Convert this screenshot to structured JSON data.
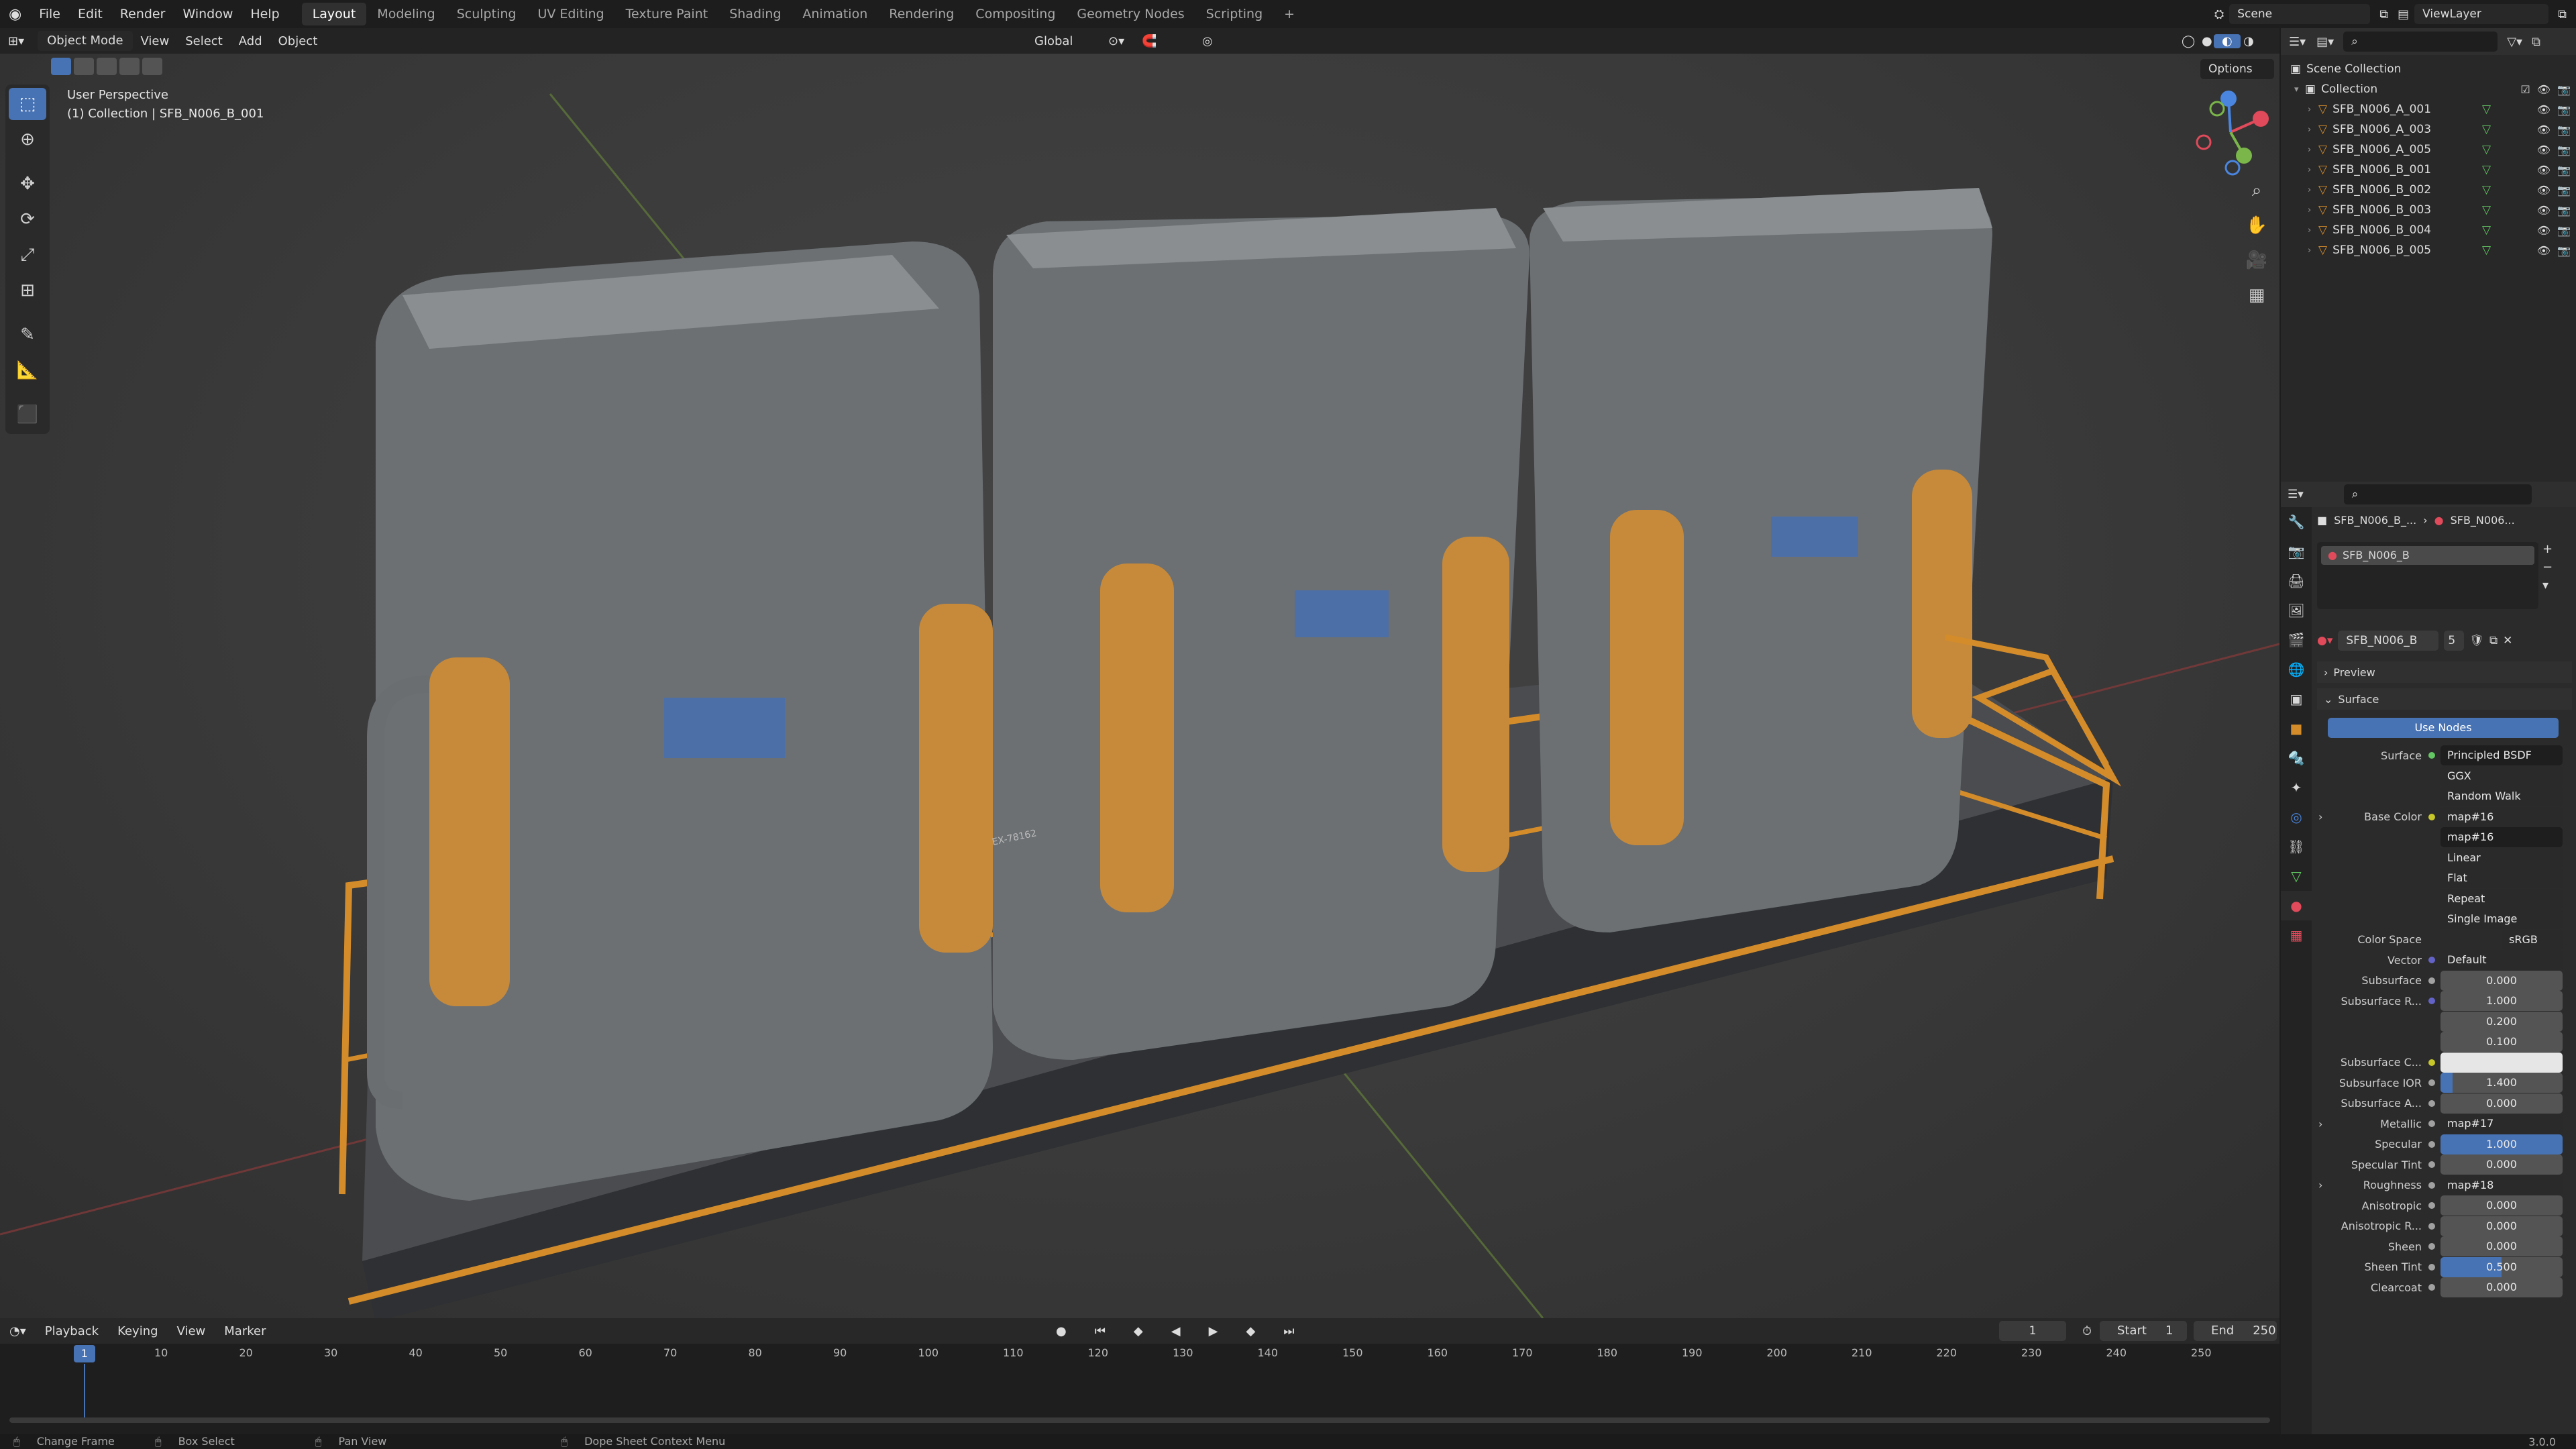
{
  "menu": [
    "File",
    "Edit",
    "Render",
    "Window",
    "Help"
  ],
  "workspaces": [
    "Layout",
    "Modeling",
    "Sculpting",
    "UV Editing",
    "Texture Paint",
    "Shading",
    "Animation",
    "Rendering",
    "Compositing",
    "Geometry Nodes",
    "Scripting"
  ],
  "active_workspace": "Layout",
  "scene": "Scene",
  "view_layer": "ViewLayer",
  "viewport": {
    "mode": "Object Mode",
    "menus": [
      "View",
      "Select",
      "Add",
      "Object"
    ],
    "transform": "Global",
    "options": "Options",
    "overlay_title": "User Perspective",
    "overlay_sub": "(1) Collection | SFB_N006_B_001",
    "decal_text": "EX-78162"
  },
  "outliner": {
    "scene_collection": "Scene Collection",
    "collection": "Collection",
    "items": [
      "SFB_N006_A_001",
      "SFB_N006_A_003",
      "SFB_N006_A_005",
      "SFB_N006_B_001",
      "SFB_N006_B_002",
      "SFB_N006_B_003",
      "SFB_N006_B_004",
      "SFB_N006_B_005"
    ]
  },
  "properties": {
    "breadcrumb_obj": "SFB_N006_B_...",
    "breadcrumb_mat": "SFB_N006...",
    "slot": "SFB_N006_B",
    "material": "SFB_N006_B",
    "users": "5",
    "preview": "Preview",
    "surface_panel": "Surface",
    "use_nodes": "Use Nodes",
    "rows": [
      {
        "label": "Surface",
        "value": "Principled BSDF",
        "kind": "dark",
        "dot": "#63c763"
      },
      {
        "label": "",
        "value": "GGX",
        "kind": "dd"
      },
      {
        "label": "",
        "value": "Random Walk",
        "kind": "dd"
      },
      {
        "label": "Base Color",
        "value": "map#16",
        "kind": "sel",
        "dot": "#c7c729",
        "tri": true
      },
      {
        "label": "",
        "value": "map#16",
        "kind": "img"
      },
      {
        "label": "",
        "value": "Linear",
        "kind": "dd"
      },
      {
        "label": "",
        "value": "Flat",
        "kind": "dd"
      },
      {
        "label": "",
        "value": "Repeat",
        "kind": "dd"
      },
      {
        "label": "",
        "value": "Single Image",
        "kind": "dd"
      },
      {
        "label": "Color Space",
        "value": "sRGB",
        "kind": "cs"
      },
      {
        "label": "Vector",
        "value": "Default",
        "kind": "sel",
        "dot": "#6363c7"
      },
      {
        "label": "Subsurface",
        "value": "0.000",
        "kind": "num",
        "dot": "#a1a1a1"
      },
      {
        "label": "Subsurface R...",
        "value": "1.000",
        "kind": "num",
        "dot": "#6363c7"
      },
      {
        "label": "",
        "value": "0.200",
        "kind": "num"
      },
      {
        "label": "",
        "value": "0.100",
        "kind": "num"
      },
      {
        "label": "Subsurface C...",
        "value": "",
        "kind": "white",
        "dot": "#c7c729"
      },
      {
        "label": "Subsurface IOR",
        "value": "1.400",
        "kind": "num",
        "dot": "#a1a1a1",
        "fill": 0.1
      },
      {
        "label": "Subsurface A...",
        "value": "0.000",
        "kind": "num",
        "dot": "#a1a1a1"
      },
      {
        "label": "Metallic",
        "value": "map#17",
        "kind": "sel",
        "dot": "#a1a1a1",
        "tri": true
      },
      {
        "label": "Specular",
        "value": "1.000",
        "kind": "blue",
        "dot": "#a1a1a1"
      },
      {
        "label": "Specular Tint",
        "value": "0.000",
        "kind": "num",
        "dot": "#a1a1a1"
      },
      {
        "label": "Roughness",
        "value": "map#18",
        "kind": "sel",
        "dot": "#a1a1a1",
        "tri": true
      },
      {
        "label": "Anisotropic",
        "value": "0.000",
        "kind": "num",
        "dot": "#a1a1a1"
      },
      {
        "label": "Anisotropic R...",
        "value": "0.000",
        "kind": "num",
        "dot": "#a1a1a1"
      },
      {
        "label": "Sheen",
        "value": "0.000",
        "kind": "num",
        "dot": "#a1a1a1"
      },
      {
        "label": "Sheen Tint",
        "value": "0.500",
        "kind": "num",
        "dot": "#a1a1a1",
        "fill": 0.5
      },
      {
        "label": "Clearcoat",
        "value": "0.000",
        "kind": "num",
        "dot": "#a1a1a1"
      }
    ]
  },
  "timeline": {
    "menus": [
      "Playback",
      "Keying",
      "View",
      "Marker"
    ],
    "current_frame": "1",
    "start_label": "Start",
    "start": "1",
    "end_label": "End",
    "end": "250",
    "ticks": [
      "10",
      "20",
      "30",
      "40",
      "50",
      "60",
      "70",
      "80",
      "90",
      "100",
      "110",
      "120",
      "130",
      "140",
      "150",
      "160",
      "170",
      "180",
      "190",
      "200",
      "210",
      "220",
      "230",
      "240",
      "250"
    ]
  },
  "statusbar": {
    "items": [
      "Change Frame",
      "Box Select",
      "Pan View",
      "Dope Sheet Context Menu"
    ],
    "version": "3.0.0"
  },
  "colors": {
    "accent": "#4772b3",
    "orange": "#d48c2a",
    "panel": "#2b2b2b"
  }
}
